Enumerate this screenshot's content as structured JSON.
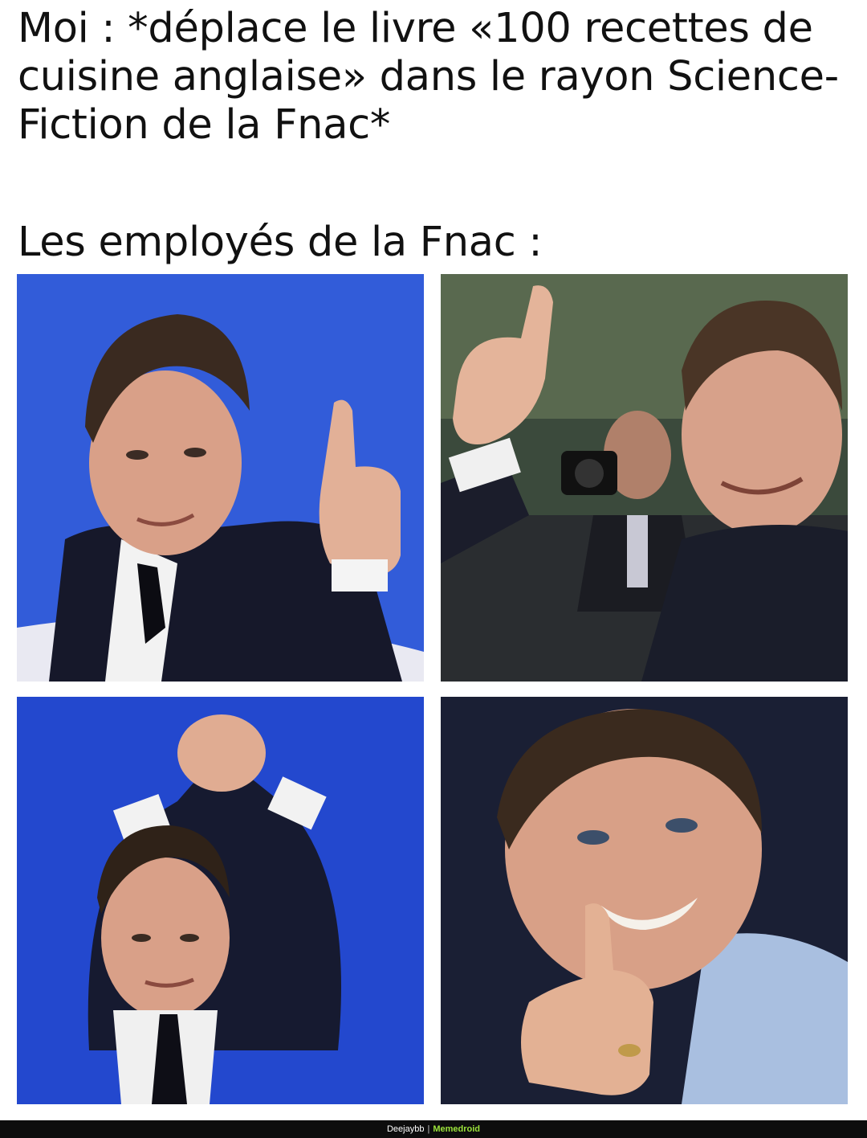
{
  "meme": {
    "caption_top": "Moi : *déplace le livre «100 recettes de cuisine anglaise» dans le rayon Science-Fiction de la Fnac*",
    "caption_bottom": "Les employés de la Fnac :"
  },
  "photos": [
    {
      "background": "#2f58d6",
      "subject": "man-thumbs-up"
    },
    {
      "background": "#3b4a3c",
      "subject": "man-thumbs-up-crowd"
    },
    {
      "background": "#1f42c8",
      "subject": "man-hands-clasped-overhead"
    },
    {
      "background": "#14182a",
      "subject": "man-thumbs-up-grin"
    }
  ],
  "footer": {
    "author": "Deejaybb",
    "separator": "|",
    "site": "Memedroid"
  }
}
